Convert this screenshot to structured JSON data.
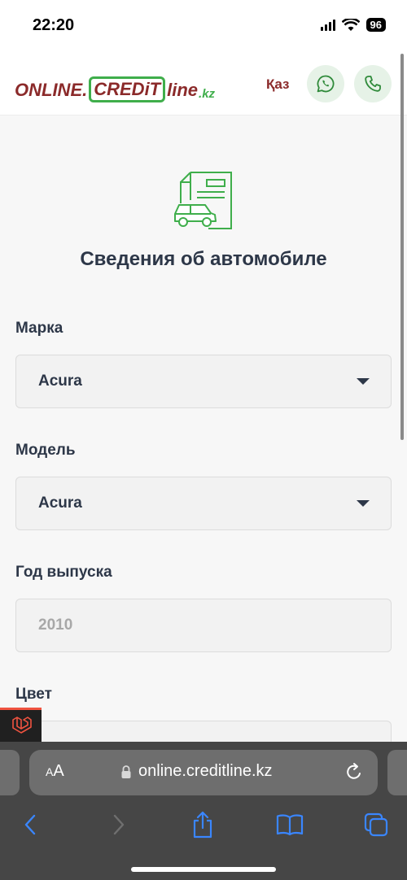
{
  "status_bar": {
    "time": "22:20",
    "battery": "96"
  },
  "header": {
    "logo": {
      "part1": "ONLINE.",
      "part2": "CREDiT",
      "part3": "line",
      "part4": ".kz"
    },
    "lang_label": "Қаз"
  },
  "page": {
    "title": "Сведения об автомобиле",
    "fields": {
      "make": {
        "label": "Марка",
        "value": "Acura"
      },
      "model": {
        "label": "Модель",
        "value": "Acura"
      },
      "year": {
        "label": "Год выпуска",
        "placeholder": "2010"
      },
      "color": {
        "label": "Цвет"
      }
    }
  },
  "browser": {
    "text_size_label_small": "A",
    "text_size_label_large": "A",
    "url": "online.creditline.kz"
  },
  "colors": {
    "brand_red": "#8b2a2a",
    "brand_green": "#3fae4b"
  }
}
